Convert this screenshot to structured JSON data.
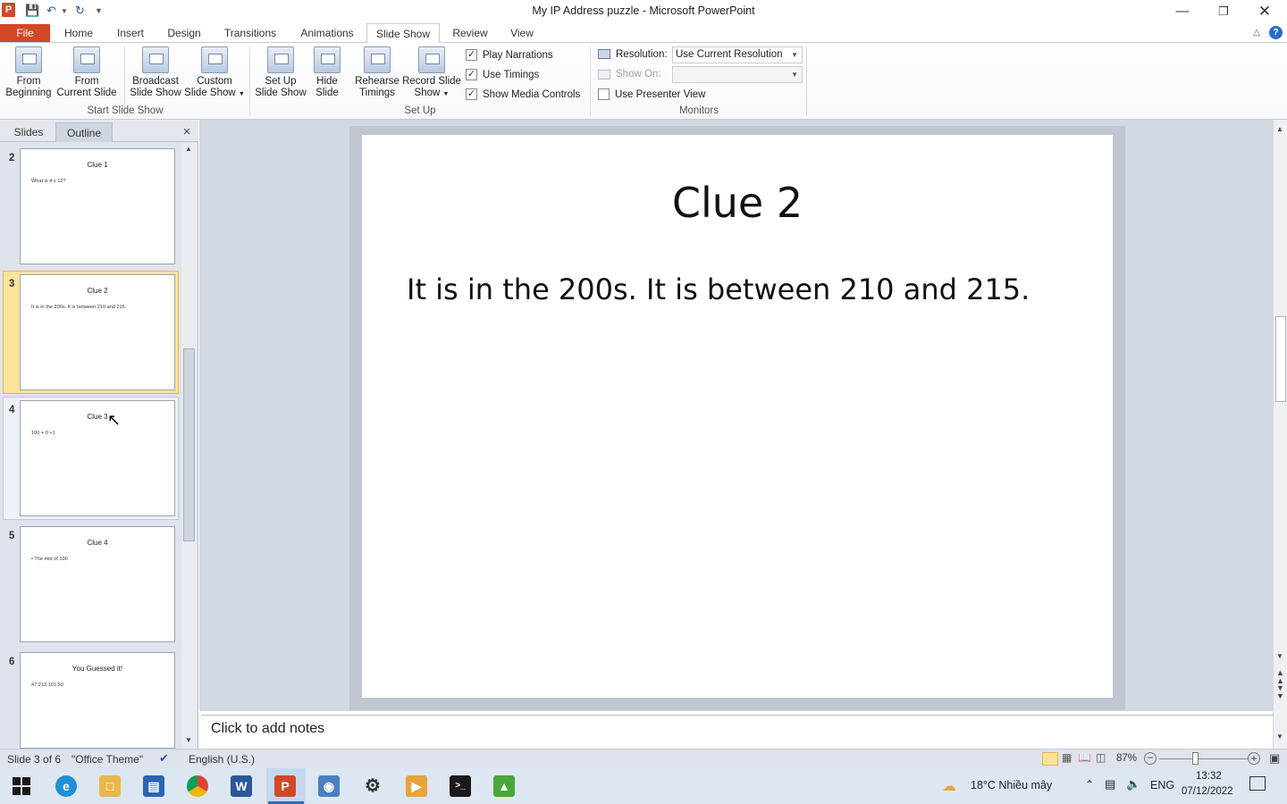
{
  "window": {
    "title": "My IP Address puzzle  -  Microsoft PowerPoint",
    "app_icon": "P"
  },
  "tabs": [
    "File",
    "Home",
    "Insert",
    "Design",
    "Transitions",
    "Animations",
    "Slide Show",
    "Review",
    "View"
  ],
  "ribbon": {
    "from_beginning": [
      "From",
      "Beginning"
    ],
    "from_current": [
      "From",
      "Current Slide"
    ],
    "broadcast": [
      "Broadcast",
      "Slide Show"
    ],
    "custom": [
      "Custom",
      "Slide Show"
    ],
    "group_start": "Start Slide Show",
    "setup": [
      "Set Up",
      "Slide Show"
    ],
    "hide": [
      "Hide",
      "Slide"
    ],
    "rehearse": [
      "Rehearse",
      "Timings"
    ],
    "record": [
      "Record Slide",
      "Show"
    ],
    "group_setup": "Set Up",
    "play_narrations": "Play Narrations",
    "use_timings": "Use Timings",
    "show_media": "Show Media Controls",
    "resolution_label": "Resolution:",
    "resolution_value": "Use Current Resolution",
    "show_on_label": "Show On:",
    "presenter_view": "Use Presenter View",
    "group_monitors": "Monitors"
  },
  "pane": {
    "tab_slides": "Slides",
    "tab_outline": "Outline",
    "close": "×"
  },
  "thumbs": [
    {
      "num": "2",
      "title": "Clue 1",
      "body": "What is 4 x 12?"
    },
    {
      "num": "3",
      "title": "Clue 2",
      "body": "It is in the 200s. It is between 210 and 215."
    },
    {
      "num": "4",
      "title": "Clue 3",
      "body": "100 + 0 +1"
    },
    {
      "num": "5",
      "title": "Clue 4",
      "body": "•  The mid of 100"
    },
    {
      "num": "6",
      "title": "You Guessed it!",
      "body": "47.213.101.50"
    }
  ],
  "slide": {
    "title": "Clue 2",
    "body": "It is in the 200s. It is between 210 and 215."
  },
  "notes": {
    "placeholder": "Click to add notes"
  },
  "status": {
    "slide": "Slide 3 of 6",
    "theme": "\"Office Theme\"",
    "language": "English (U.S.)",
    "zoom": "87%"
  },
  "taskbar": {
    "weather": "18°C  Nhiều mây",
    "lang": "ENG",
    "time": "13:32",
    "date": "07/12/2022"
  }
}
